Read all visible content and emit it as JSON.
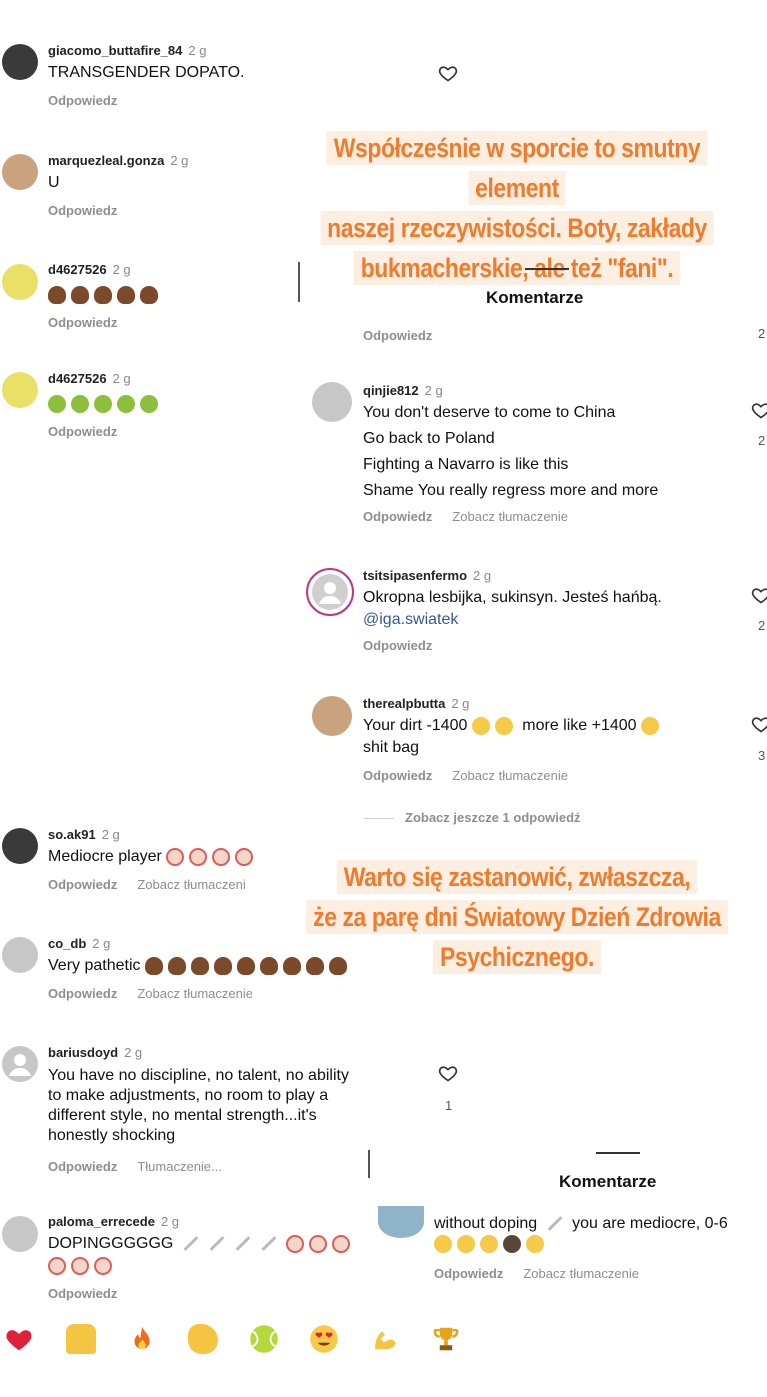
{
  "banners": {
    "top": [
      "Współcześnie w sporcie to smutny element",
      "naszej rzeczywistości. Boty, zakłady",
      "bukmacherskie, ale też \"fani\"."
    ],
    "middle": [
      "Warto się zastanowić, zwłaszcza,",
      "że za parę dni Światowy Dzień Zdrowia",
      "Psychicznego."
    ]
  },
  "left_comments": [
    {
      "user": "giacomo_buttafire_84",
      "time": "2 g",
      "text": "TRANSGENDER DOPATO.",
      "reply": "Odpowiedz"
    },
    {
      "user": "marquezleal.gonza",
      "time": "2 g",
      "text": "U",
      "reply": "Odpowiedz"
    },
    {
      "user": "d4627526",
      "time": "2 g",
      "reply": "Odpowiedz"
    },
    {
      "user": "d4627526",
      "time": "2 g",
      "reply": "Odpowiedz"
    },
    {
      "user": "so.ak91",
      "time": "2 g",
      "text": "Mediocre player",
      "reply": "Odpowiedz",
      "translate": "Zobacz tłumaczeni"
    },
    {
      "user": "co_db",
      "time": "2 g",
      "text": "Very pathetic",
      "reply": "Odpowiedz",
      "translate": "Zobacz tłumaczenie"
    },
    {
      "user": "bariusdoyd",
      "time": "2 g",
      "lines": [
        "You have no discipline, no talent, no ability",
        "to make adjustments, no room to play a",
        "different style, no mental strength...it's",
        "honestly shocking"
      ],
      "reply": "Odpowiedz",
      "translate": "Tłumaczenie...",
      "likes": "1"
    },
    {
      "user": "paloma_errecede",
      "time": "2 g",
      "text": "DOPINGGGGGG",
      "reply": "Odpowiedz"
    }
  ],
  "right_panel": {
    "title": "Komentarze",
    "top_reply": "Odpowiedz",
    "top_count": "2",
    "comments": [
      {
        "user": "qinjie812",
        "time": "2 g",
        "lines": [
          "You don't deserve to come to China",
          "Go back to Poland",
          "Fighting a Navarro is like this",
          "Shame You really regress more and more"
        ],
        "reply": "Odpowiedz",
        "translate": "Zobacz tłumaczenie",
        "count": "2"
      },
      {
        "user": "tsitsipasenfermo",
        "time": "2 g",
        "text": "Okropna lesbijka, sukinsyn. Jesteś hańbą.",
        "mention": "@iga.swiatek",
        "reply": "Odpowiedz",
        "count": "2"
      },
      {
        "user": "therealpbutta",
        "time": "2 g",
        "text_a": "Your dirt -1400",
        "text_b": "more like +1400",
        "text_c": "shit bag",
        "reply": "Odpowiedz",
        "translate": "Zobacz tłumaczenie",
        "count": "3"
      }
    ],
    "more_replies": "Zobacz jeszcze 1 odpowiedź"
  },
  "bottom_panel": {
    "title": "Komentarze",
    "text_a": "without doping",
    "text_b": "you are mediocre, 0-6",
    "reply": "Odpowiedz",
    "translate": "Zobacz tłumaczenie"
  },
  "reactions": [
    "heart",
    "raising-hands",
    "fire",
    "clapping",
    "tennis-ball",
    "heart-eyes",
    "flexed-biceps",
    "trophy"
  ]
}
